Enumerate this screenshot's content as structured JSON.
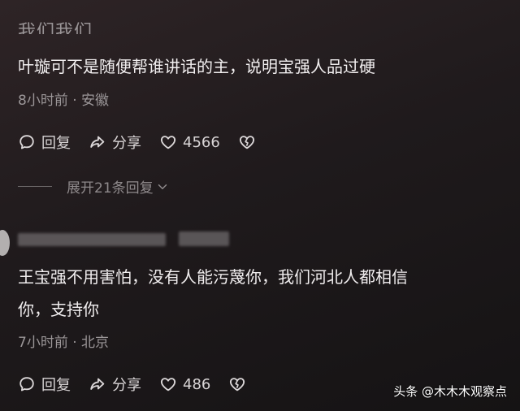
{
  "comment1": {
    "username": "我们我们我",
    "text": "叶璇可不是随便帮谁讲话的主，说明宝强人品过硬",
    "meta": "8小时前 · 安徽",
    "reply_label": "回复",
    "share_label": "分享",
    "like_count": "4566"
  },
  "expand_replies_label": "展开21条回复",
  "comment2": {
    "text_line1": "王宝强不用害怕，没有人能污蔑你，我们河北人都相信",
    "text_line2": "你，支持你",
    "meta": "7小时前 · 北京",
    "reply_label": "回复",
    "share_label": "分享",
    "like_count": "486"
  },
  "watermark": "头条 @木木木观察点"
}
